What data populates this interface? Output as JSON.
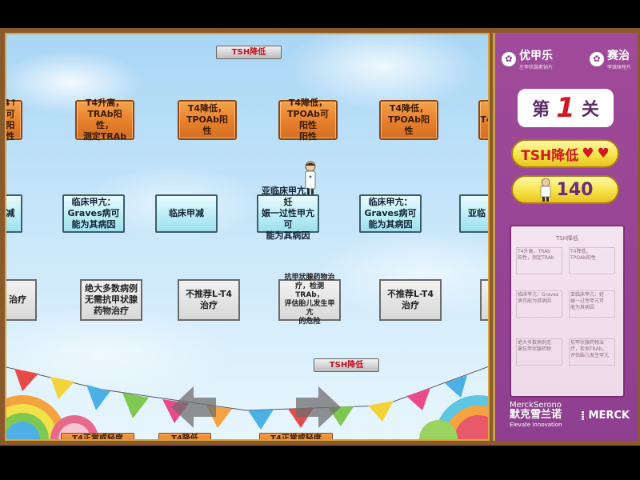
{
  "board": {
    "top_pill": "TSH降低",
    "mid_pill": "TSH降低",
    "row1": [
      {
        "text": "4↑\n可阳性"
      },
      {
        "text": "T4升高，\nTRAb阳性，\n测定TRAb"
      },
      {
        "text": "T4降低，\nTPOAb阳性"
      },
      {
        "text": "T4降低，\nTPOAb可阳性\n阳性"
      },
      {
        "text": "T4降低，\nTPOAb阳性"
      },
      {
        "text": "T4"
      }
    ],
    "row2": [
      {
        "text": "减"
      },
      {
        "text": "临床甲亢：\nGraves病可\n能为其病因"
      },
      {
        "text": "临床甲减"
      },
      {
        "text": "亚临床甲亢：妊\n娠一过性甲亢可\n能为其病因"
      },
      {
        "text": "临床甲亢：\nGraves病可\n能为其病因"
      },
      {
        "text": "亚临"
      }
    ],
    "row3": [
      {
        "text": "治疗"
      },
      {
        "text": "绝大多数病例\n无需抗甲状腺\n药物治疗"
      },
      {
        "text": "不推荐L-T4治疗"
      },
      {
        "text": "抗甲状腺药物治\n疗，检测TRAb，\n评估胎儿发生甲亢\n的危险"
      },
      {
        "text": "不推荐L-T4治疗"
      },
      {
        "text": ""
      }
    ],
    "bottom_labels": [
      "T4正常或轻度",
      "T4降低",
      "T4正常或轻度"
    ]
  },
  "panel": {
    "logo_left": {
      "name": "优甲乐",
      "sub": "左甲状腺素钠片"
    },
    "logo_right": {
      "name": "赛治",
      "sub": "甲巯咪唑片"
    },
    "level": {
      "prefix": "第",
      "number": "1",
      "suffix": "关"
    },
    "target": "TSH降低",
    "lives": 2,
    "score": "140",
    "preview": {
      "title": "TSH降低",
      "cells": [
        "T4升高，TRAb\n阳性，测定TRAb",
        "T4降低，\nTPOAb阳性",
        "临床甲亢：Graves\n病可能为其病因",
        "亚临床甲亢：妊\n娠一过性甲亢可\n能为其病因",
        "绝大多数病例无\n需抗甲状腺药物",
        "抗甲状腺药物治\n疗，检测TRAb，\n评估胎儿发生甲亢"
      ]
    },
    "footer": {
      "brand_en": "MerckSerono",
      "brand_cn": "默克雪兰诺",
      "brand_tag": "Elevate Innovation",
      "merck": "MERCK"
    }
  },
  "colors": {
    "panel": "#8e3f8f",
    "accent_red": "#d01824",
    "wood": "#e8822e"
  }
}
